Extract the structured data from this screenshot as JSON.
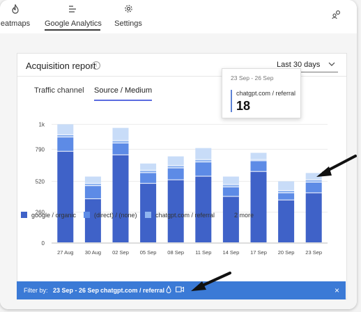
{
  "nav": {
    "items": [
      {
        "label": "eatmaps",
        "icon": "flame-icon"
      },
      {
        "label": "Google Analytics",
        "icon": "bars-icon"
      },
      {
        "label": "Settings",
        "icon": "gear-icon"
      }
    ],
    "active": "Google Analytics"
  },
  "card": {
    "title": "Acquisition report",
    "date_range": "Last 30 days",
    "tabs": [
      "Traffic channel",
      "Source / Medium"
    ],
    "active_tab": "Source / Medium"
  },
  "tooltip": {
    "range": "23 Sep - 26 Sep",
    "label": "chatgpt.com / referral",
    "value": "18"
  },
  "legend": {
    "items": [
      {
        "label": "google / organic",
        "color": "#3f62c8"
      },
      {
        "label": "(direct) / (none)",
        "color": "#5d8be6"
      },
      {
        "label": "chatgpt.com / referral",
        "color": "#8fb4f0"
      }
    ],
    "more": "2 more"
  },
  "filter": {
    "label": "Filter by:",
    "range": "23 Sep - 26 Sep",
    "source": "chatgpt.com / referral",
    "close": "×"
  },
  "chart_data": {
    "type": "bar",
    "stacked": true,
    "categories": [
      "27 Aug",
      "30 Aug",
      "02 Sep",
      "05 Sep",
      "08 Sep",
      "11 Sep",
      "14 Sep",
      "17 Sep",
      "20 Sep",
      "23 Sep"
    ],
    "y_ticks": [
      "0",
      "260",
      "520",
      "790",
      "1k"
    ],
    "ylim": [
      0,
      1050
    ],
    "series": [
      {
        "name": "google / organic",
        "color": "#3f62c8",
        "values": [
          770,
          370,
          740,
          500,
          530,
          560,
          390,
          600,
          360,
          420
        ]
      },
      {
        "name": "(direct) / (none)",
        "color": "#5d8be6",
        "values": [
          120,
          110,
          100,
          90,
          100,
          120,
          80,
          90,
          60,
          90
        ]
      },
      {
        "name": "chatgpt.com / referral",
        "color": "#8fb4f0",
        "values": [
          20,
          20,
          20,
          20,
          20,
          20,
          20,
          10,
          20,
          20
        ]
      },
      {
        "name": "more",
        "color": "#c8dcf8",
        "values": [
          90,
          60,
          110,
          60,
          80,
          100,
          70,
          60,
          80,
          60
        ]
      }
    ],
    "selected_index": 9,
    "grid": true
  }
}
